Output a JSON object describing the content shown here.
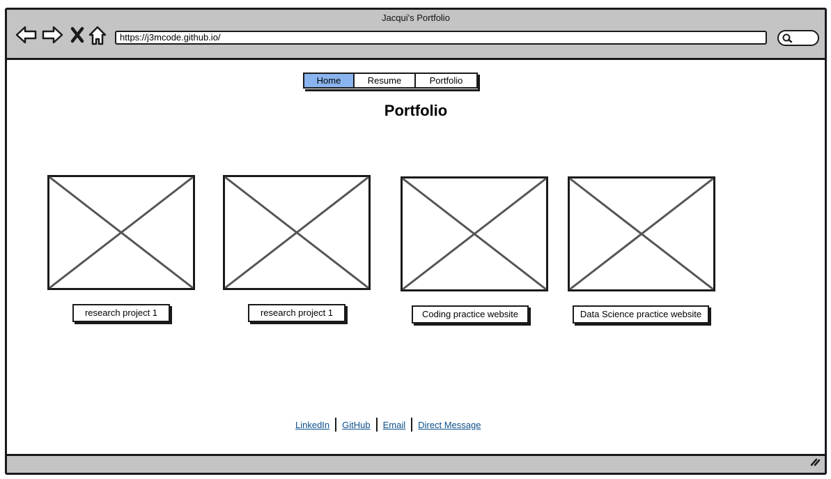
{
  "browser": {
    "title": "Jacqui's Portfolio",
    "url": "https://j3mcode.github.io/",
    "icons": [
      "back-icon",
      "forward-icon",
      "close-icon",
      "home-icon",
      "search-icon"
    ]
  },
  "nav": {
    "tabs": [
      {
        "label": "Home",
        "active": true
      },
      {
        "label": "Resume",
        "active": false
      },
      {
        "label": "Portfolio",
        "active": false
      }
    ]
  },
  "page": {
    "title": "Portfolio"
  },
  "projects": [
    {
      "label": "research project 1"
    },
    {
      "label": "research project 1"
    },
    {
      "label": "Coding practice website"
    },
    {
      "label": "Data Science practice website"
    }
  ],
  "footer": {
    "links": [
      "LinkedIn",
      "GitHub",
      "Email",
      "Direct Message"
    ]
  },
  "colors": {
    "chrome": "#c4c4c4",
    "active_tab": "#8ab4ef",
    "link": "#0b4f8a"
  }
}
